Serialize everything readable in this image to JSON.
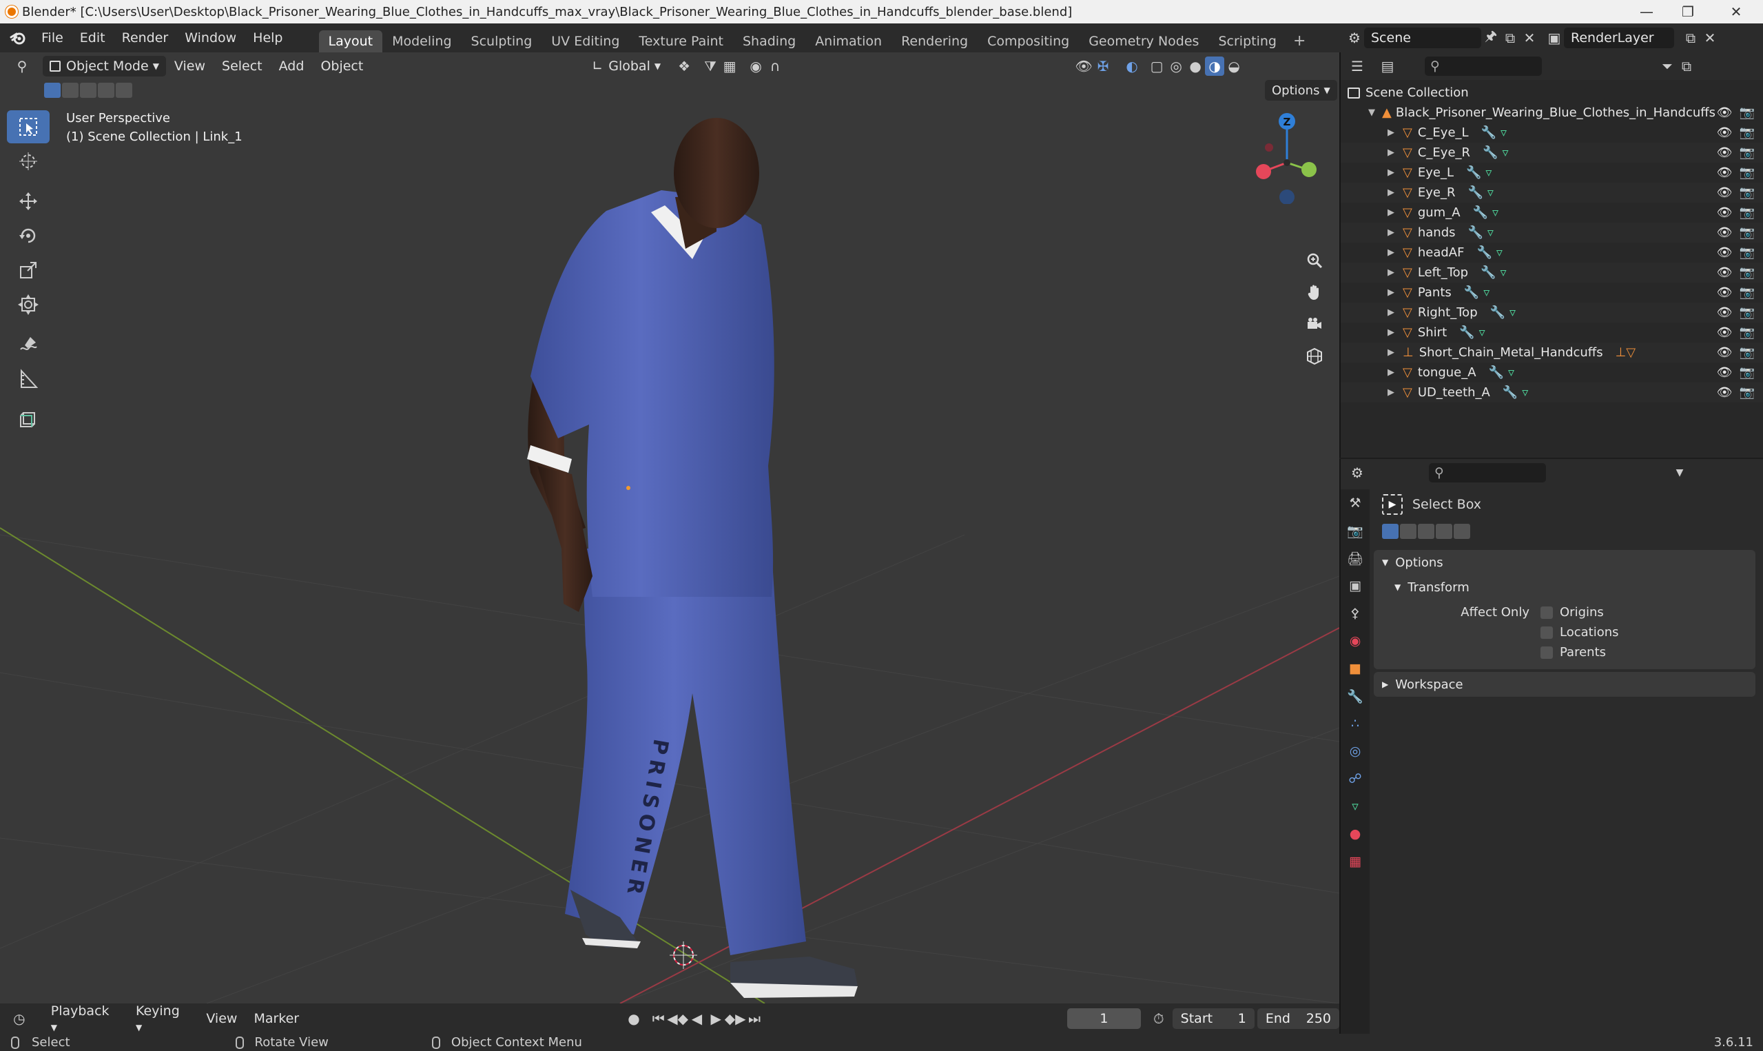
{
  "window": {
    "title": "Blender* [C:\\Users\\User\\Desktop\\Black_Prisoner_Wearing_Blue_Clothes_in_Handcuffs_max_vray\\Black_Prisoner_Wearing_Blue_Clothes_in_Handcuffs_blender_base.blend]"
  },
  "menubar": {
    "items": [
      "File",
      "Edit",
      "Render",
      "Window",
      "Help"
    ],
    "workspaces": [
      "Layout",
      "Modeling",
      "Sculpting",
      "UV Editing",
      "Texture Paint",
      "Shading",
      "Animation",
      "Rendering",
      "Compositing",
      "Geometry Nodes",
      "Scripting"
    ],
    "active_workspace": "Layout"
  },
  "scene_header": {
    "scene": "Scene",
    "view_layer": "RenderLayer"
  },
  "viewport": {
    "mode": "Object Mode",
    "menus": [
      "View",
      "Select",
      "Add",
      "Object"
    ],
    "transform_orientation": "Global",
    "options_label": "Options",
    "perspective_label": "User Perspective",
    "collection_label": "(1) Scene Collection | Link_1",
    "text_on_pants": "PRISONER"
  },
  "outliner": {
    "root": "Scene Collection",
    "collection": "Black_Prisoner_Wearing_Blue_Clothes_in_Handcuffs",
    "objects": [
      "C_Eye_L",
      "C_Eye_R",
      "Eye_L",
      "Eye_R",
      "gum_A",
      "hands",
      "headAF",
      "Left_Top",
      "Pants",
      "Right_Top",
      "Shirt",
      "Short_Chain_Metal_Handcuffs",
      "tongue_A",
      "UD_teeth_A"
    ]
  },
  "properties": {
    "tool_name": "Select Box",
    "options_label": "Options",
    "transform_label": "Transform",
    "affect_only_label": "Affect Only",
    "checks": [
      "Origins",
      "Locations",
      "Parents"
    ],
    "workspace_label": "Workspace"
  },
  "timeline": {
    "menus": [
      "Playback",
      "Keying",
      "View",
      "Marker"
    ],
    "current_frame": "1",
    "start_label": "Start",
    "start_value": "1",
    "end_label": "End",
    "end_value": "250"
  },
  "statusbar": {
    "select": "Select",
    "rotate": "Rotate View",
    "context": "Object Context Menu",
    "version": "3.6.11"
  },
  "colors": {
    "accent": "#4772b3",
    "gizmo_x": "#e5475a",
    "gizmo_y": "#8bc34a",
    "gizmo_z": "#2f7fd8",
    "orange_object": "#ef8f3a",
    "mesh_green": "#4ed39a"
  }
}
